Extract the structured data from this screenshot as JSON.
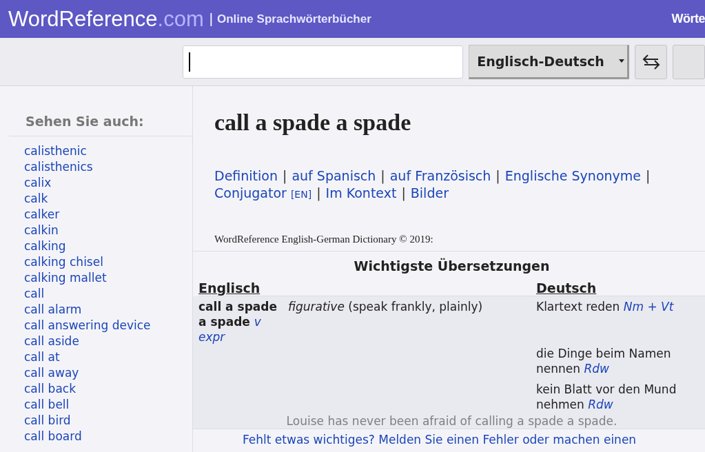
{
  "header": {
    "logo": "WordReference",
    "logo_suffix": ".com",
    "separator": "|",
    "tagline": "Online Sprachwörterbücher",
    "right_link": "Wörte"
  },
  "toolbar": {
    "language": "Englisch-Deutsch"
  },
  "sidebar": {
    "heading": "Sehen Sie auch:",
    "items": [
      "calisthenic",
      "calisthenics",
      "calix",
      "calk",
      "calker",
      "calkin",
      "calking",
      "calking chisel",
      "calking mallet",
      "call",
      "call alarm",
      "call answering device",
      "call aside",
      "call at",
      "call away",
      "call back",
      "call bell",
      "call bird",
      "call board"
    ]
  },
  "entry": {
    "title": "call a spade a spade",
    "links": [
      {
        "kind": "link",
        "text": "Definition"
      },
      {
        "kind": "separator",
        "text": "|"
      },
      {
        "kind": "link",
        "text": "auf Spanisch"
      },
      {
        "kind": "separator",
        "text": "|"
      },
      {
        "kind": "link",
        "text": "auf Französisch"
      },
      {
        "kind": "separator",
        "text": "|"
      },
      {
        "kind": "link",
        "text": "Englische Synonyme"
      },
      {
        "kind": "separator",
        "text": "|"
      },
      {
        "kind": "link",
        "text": "Conjugator",
        "tag": "[EN]"
      },
      {
        "kind": "separator",
        "text": "|"
      },
      {
        "kind": "link",
        "text": "Im Kontext"
      },
      {
        "kind": "separator",
        "text": "|"
      },
      {
        "kind": "link",
        "text": "Bilder"
      }
    ],
    "copyright": "WordReference English-German Dictionary © 2019:"
  },
  "table": {
    "title": "Wichtigste Übersetzungen",
    "columns": [
      "Englisch",
      "Deutsch"
    ],
    "row": {
      "source": "call a spade a spade",
      "pos": "v",
      "pos_2": "expr",
      "note": "*figurative* (speak frankly, plainly)",
      "translations": [
        {
          "text": "Klartext reden",
          "pos": "Nm + Vt"
        },
        {
          "text": "die Dinge beim Namen nennen",
          "pos": "Rdw"
        },
        {
          "text": "kein Blatt vor den Mund nehmen",
          "pos": "Rdw"
        }
      ],
      "example": "Louise has never been afraid of calling a spade a spade."
    }
  },
  "footer_link": "Fehlt etwas wichtiges? Melden Sie einen Fehler oder machen einen"
}
